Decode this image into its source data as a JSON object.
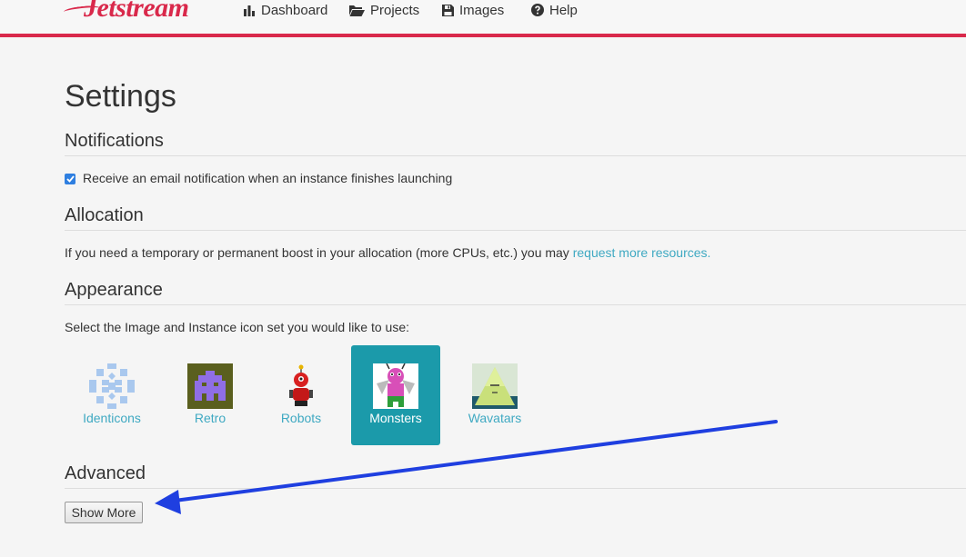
{
  "app": {
    "logo_text": "Jetstream"
  },
  "nav": {
    "dashboard": "Dashboard",
    "projects": "Projects",
    "images": "Images",
    "help": "Help"
  },
  "page": {
    "title": "Settings"
  },
  "notifications": {
    "heading": "Notifications",
    "checkbox_label": "Receive an email notification when an instance finishes launching",
    "checked": true
  },
  "allocation": {
    "heading": "Allocation",
    "text": "If you need a temporary or permanent boost in your allocation (more CPUs, etc.) you may ",
    "link": "request more resources."
  },
  "appearance": {
    "heading": "Appearance",
    "prompt": "Select the Image and Instance icon set you would like to use:",
    "icon_sets": [
      {
        "label": "Identicons",
        "selected": false
      },
      {
        "label": "Retro",
        "selected": false
      },
      {
        "label": "Robots",
        "selected": false
      },
      {
        "label": "Monsters",
        "selected": true
      },
      {
        "label": "Wavatars",
        "selected": false
      }
    ]
  },
  "advanced": {
    "heading": "Advanced",
    "button": "Show More"
  },
  "colors": {
    "brand": "#d9294b",
    "accent": "#1b9aaa",
    "link": "#3fa9c2",
    "annotation_arrow": "#1f3fe0"
  }
}
